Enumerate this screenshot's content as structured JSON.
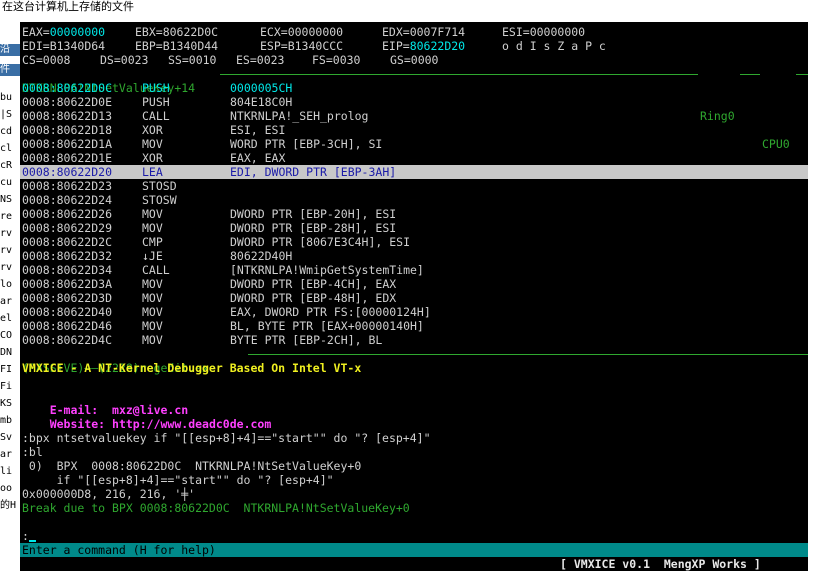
{
  "background": {
    "title": "在这台计算机上存储的文件",
    "left_fragments": [
      "沿",
      "件",
      "bu",
      "|S",
      "cd",
      "cl",
      "cR",
      "cu",
      "NS",
      "re",
      "rv",
      "rv",
      "rv",
      "lo",
      "ar",
      "el",
      "CO",
      "DN",
      "FI",
      "Fi",
      "KS",
      "mb",
      "Sv",
      "ar",
      "li",
      "oo",
      "的H"
    ]
  },
  "registers": {
    "row1": [
      {
        "name": "EAX=",
        "value": "00000000",
        "color": "cyan"
      },
      {
        "name": "EBX=",
        "value": "80622D0C",
        "color": "white"
      },
      {
        "name": "ECX=",
        "value": "00000000",
        "color": "white"
      },
      {
        "name": "EDX=",
        "value": "0007F714",
        "color": "white"
      },
      {
        "name": "ESI=",
        "value": "00000000",
        "color": "white"
      }
    ],
    "row2": [
      {
        "name": "EDI=",
        "value": "B1340D64",
        "color": "white"
      },
      {
        "name": "EBP=",
        "value": "B1340D44",
        "color": "white"
      },
      {
        "name": "ESP=",
        "value": "B1340CCC",
        "color": "white"
      },
      {
        "name": "EIP=",
        "value": "80622D20",
        "color": "cyan"
      }
    ],
    "flags": "o d I s Z a P c",
    "row3": [
      {
        "name": "CS=",
        "value": "0008"
      },
      {
        "name": "DS=",
        "value": "0023"
      },
      {
        "name": "SS=",
        "value": "0010"
      },
      {
        "name": "ES=",
        "value": "0023"
      },
      {
        "name": "FS=",
        "value": "0030"
      },
      {
        "name": "GS=",
        "value": "0000"
      }
    ]
  },
  "code_header": {
    "function": "NTKRNLPA!NtSetValueKey+14",
    "ring": "Ring0",
    "cpu": "CPU0"
  },
  "disassembly": [
    {
      "addr": "0008:80622D0C",
      "mnem": "PUSH",
      "ops": "0000005CH",
      "style": "current"
    },
    {
      "addr": "0008:80622D0E",
      "mnem": "PUSH",
      "ops": "804E18C0H",
      "style": "normal"
    },
    {
      "addr": "0008:80622D13",
      "mnem": "CALL",
      "ops": "NTKRNLPA!_SEH_prolog",
      "style": "normal"
    },
    {
      "addr": "0008:80622D18",
      "mnem": "XOR",
      "ops": "ESI, ESI",
      "style": "normal"
    },
    {
      "addr": "0008:80622D1A",
      "mnem": "MOV",
      "ops": "WORD PTR [EBP-3CH], SI",
      "style": "normal"
    },
    {
      "addr": "0008:80622D1E",
      "mnem": "XOR",
      "ops": "EAX, EAX",
      "style": "normal"
    },
    {
      "addr": "0008:80622D20",
      "mnem": "LEA",
      "ops": "EDI, DWORD PTR [EBP-3AH]",
      "style": "selected"
    },
    {
      "addr": "0008:80622D23",
      "mnem": "STOSD",
      "ops": "",
      "style": "normal"
    },
    {
      "addr": "0008:80622D24",
      "mnem": "STOSW",
      "ops": "",
      "style": "normal"
    },
    {
      "addr": "0008:80622D26",
      "mnem": "MOV",
      "ops": "DWORD PTR [EBP-20H], ESI",
      "style": "normal"
    },
    {
      "addr": "0008:80622D29",
      "mnem": "MOV",
      "ops": "DWORD PTR [EBP-28H], ESI",
      "style": "normal"
    },
    {
      "addr": "0008:80622D2C",
      "mnem": "CMP",
      "ops": "DWORD PTR [8067E3C4H], ESI",
      "style": "normal"
    },
    {
      "addr": "0008:80622D32",
      "mnem": "↓JE",
      "ops": "80622D40H",
      "style": "normal"
    },
    {
      "addr": "0008:80622D34",
      "mnem": "CALL",
      "ops": "[NTKRNLPA!WmipGetSystemTime]",
      "style": "normal"
    },
    {
      "addr": "0008:80622D3A",
      "mnem": "MOV",
      "ops": "DWORD PTR [EBP-4CH], EAX",
      "style": "normal"
    },
    {
      "addr": "0008:80622D3D",
      "mnem": "MOV",
      "ops": "DWORD PTR [EBP-48H], EDX",
      "style": "normal"
    },
    {
      "addr": "0008:80622D40",
      "mnem": "MOV",
      "ops": "EAX, DWORD PTR FS:[00000124H]",
      "style": "normal"
    },
    {
      "addr": "0008:80622D46",
      "mnem": "MOV",
      "ops": "BL, BYTE PTR [EAX+00000140H]",
      "style": "normal"
    },
    {
      "addr": "0008:80622D4C",
      "mnem": "MOV",
      "ops": "BYTE PTR [EBP-2CH], BL",
      "style": "normal"
    }
  ],
  "context_bar": "(PASSIVE)——(2228)regedit.exe",
  "console": {
    "banner": "VMXICE - A NT-Kernel Debugger Based On Intel VT-x",
    "email_label": "E-mail:",
    "email": "mxz@live.cn",
    "website_label": "Website:",
    "website": "http://www.deadc0de.com",
    "lines": [
      {
        "text": ":bpx ntsetvaluekey if \"[[esp+8]+4]==\"start\"\" do \"? [esp+4]\"",
        "color": "white"
      },
      {
        "text": ":bl",
        "color": "white"
      },
      {
        "text": " 0)  BPX  0008:80622D0C  NTKRNLPA!NtSetValueKey+0",
        "color": "white"
      },
      {
        "text": "     if \"[[esp+8]+4]==\"start\"\" do \"? [esp+4]\"",
        "color": "white"
      },
      {
        "text": "0x000000D8, 216, 216, '╪'",
        "color": "white"
      },
      {
        "text": "Break due to BPX 0008:80622D0C  NTKRNLPA!NtSetValueKey+0",
        "color": "green"
      }
    ],
    "prompt": ":"
  },
  "command_hint": "Enter a command (H for help)",
  "status": "[ VMXICE v0.1  MengXP Works ]"
}
